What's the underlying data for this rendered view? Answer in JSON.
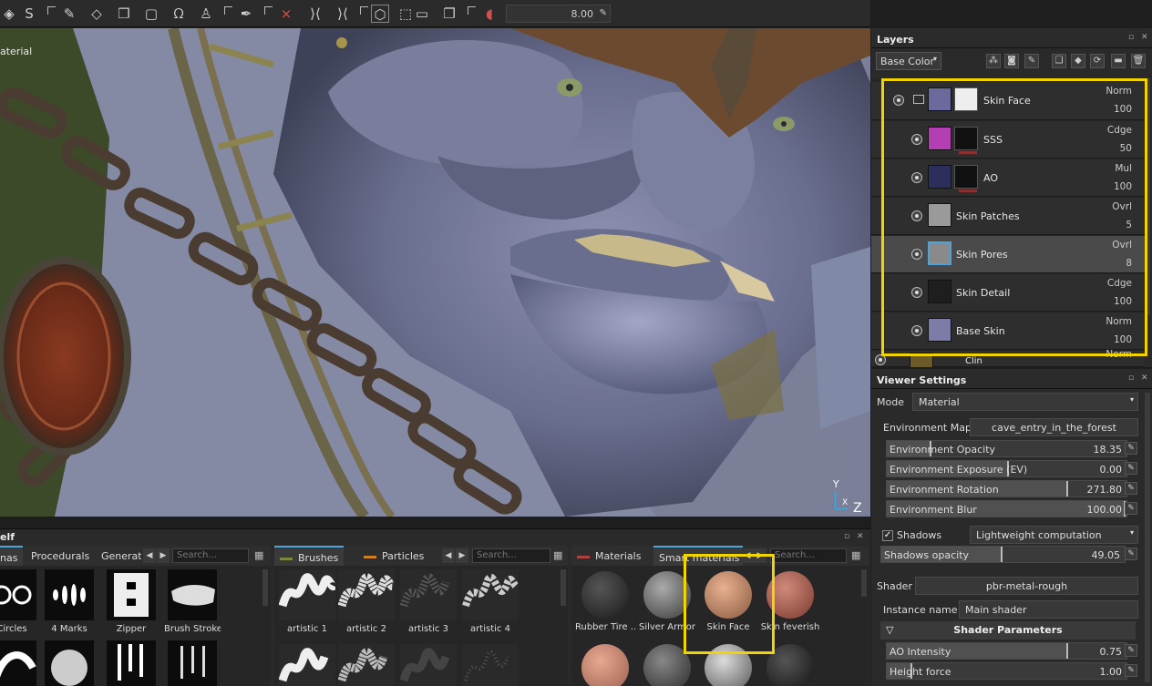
{
  "toolbar": {
    "icons": [
      "paint-icon",
      "substance-icon",
      "projection-icon",
      "eraser-icon",
      "material-pick-icon",
      "polygon-fill-icon",
      "lasso-icon",
      "clone-stamp-icon",
      "smudge-icon",
      "symmetry-icon",
      "mirror-icon",
      "camera-icon",
      "screenshot-icon",
      "video-icon",
      "3d-view-icon",
      "radial-icon"
    ],
    "slider_value": "8.00"
  },
  "viewport": {
    "label": "aterial",
    "axis": {
      "y": "Y",
      "x": "X",
      "z": "Z"
    }
  },
  "layers": {
    "title": "Layers",
    "channel": "Base Color",
    "top_partial": "100",
    "rows": [
      {
        "name": "Skin Face",
        "blend": "Norm",
        "opacity": "100",
        "thumb_color": "#6c6a9c",
        "mask": true,
        "folder": true
      },
      {
        "name": "SSS",
        "blend": "Cdge",
        "opacity": "50",
        "thumb_color": "#b43fb4",
        "mask": true
      },
      {
        "name": "AO",
        "blend": "Mul",
        "opacity": "100",
        "thumb_color": "#2c2e5c",
        "mask": true
      },
      {
        "name": "Skin Patches",
        "blend": "Ovrl",
        "opacity": "5",
        "thumb_color": "#9a9a9a"
      },
      {
        "name": "Skin Pores",
        "blend": "Ovrl",
        "opacity": "8",
        "thumb_color": "#8a8a8a",
        "selected": true
      },
      {
        "name": "Skin Detail",
        "blend": "Cdge",
        "opacity": "100",
        "thumb_color": "#1e1e1e"
      },
      {
        "name": "Base Skin",
        "blend": "Norm",
        "opacity": "100",
        "thumb_color": "#7d7ba8"
      }
    ],
    "bottom_partial": {
      "name": "Clin",
      "blend": "Norm"
    }
  },
  "viewer": {
    "title": "Viewer Settings",
    "mode_label": "Mode",
    "mode_value": "Material",
    "env_map_label": "Environment Map",
    "env_map_value": "cave_entry_in_the_forest",
    "sliders": [
      {
        "label": "Environment Opacity",
        "value": "18.35",
        "fraction": 0.18
      },
      {
        "label": "Environment Exposure (EV)",
        "value": "0.00",
        "fraction": 0.5
      },
      {
        "label": "Environment Rotation",
        "value": "271.80",
        "fraction": 0.75
      },
      {
        "label": "Environment Blur",
        "value": "100.00",
        "fraction": 1.0
      }
    ],
    "shadows_label": "Shadows",
    "shadows_checked": "✓",
    "shadows_mode": "Lightweight computation",
    "shadows_opacity_label": "Shadows opacity",
    "shadows_opacity_value": "49.05",
    "shadows_opacity_fraction": 0.49,
    "shader_label": "Shader",
    "shader_value": "pbr-metal-rough",
    "instance_label": "Instance name",
    "instance_value": "Main shader",
    "shader_params_title": "Shader Parameters",
    "params": [
      {
        "label": "AO Intensity",
        "value": "0.75",
        "fraction": 0.75
      },
      {
        "label": "Height force",
        "value": "1.00",
        "fraction": 0.1
      }
    ]
  },
  "shelf": {
    "title": "elf",
    "pane1": {
      "tabs": [
        "nas",
        "Procedurals",
        "Generato"
      ],
      "search_placeholder": "Search...",
      "items": [
        "Circles",
        "4 Marks",
        "Zipper",
        "Brush Stroke..."
      ]
    },
    "pane2": {
      "tabs": [
        "Brushes",
        "Particles"
      ],
      "search_placeholder": "Search...",
      "items": [
        "artistic 1",
        "artistic 2",
        "artistic 3",
        "artistic 4"
      ]
    },
    "pane3": {
      "tabs": [
        "Materials",
        "Smart materials"
      ],
      "search_placeholder": "Search...",
      "items": [
        {
          "name": "Rubber Tire ...",
          "color": "#2a2a2a"
        },
        {
          "name": "Silver Armor",
          "color": "#6a6a6a"
        },
        {
          "name": "Skin Face",
          "color": "#c48a6a"
        },
        {
          "name": "Skin feverish",
          "color": "#b86a5a"
        }
      ]
    }
  }
}
